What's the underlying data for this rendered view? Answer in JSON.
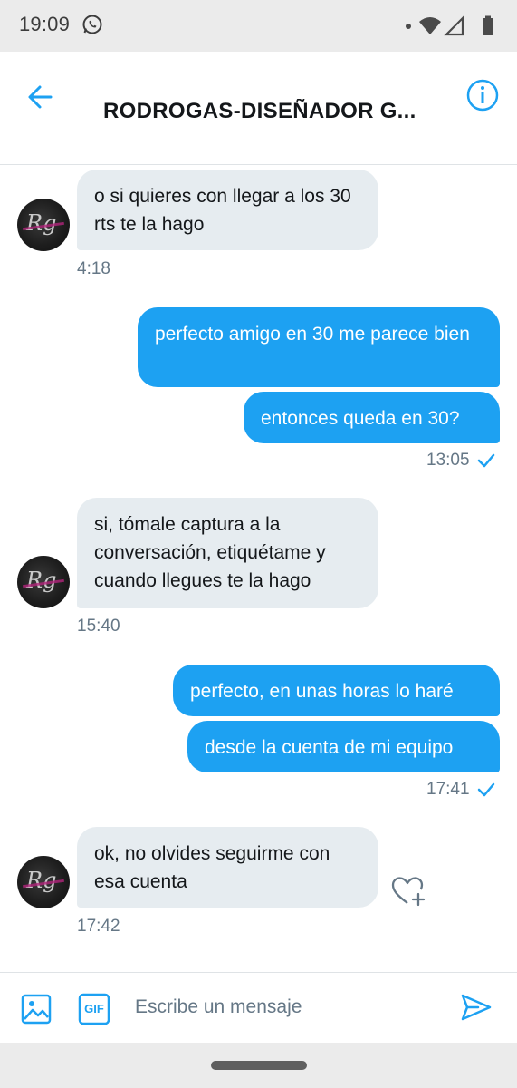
{
  "status_bar": {
    "time": "19:09",
    "battery": "79"
  },
  "header": {
    "title": "RODROGAS-DISEÑADOR G..."
  },
  "messages": [
    {
      "direction": "incoming",
      "text": "o si quieres con llegar a los 30 rts te la hago",
      "time": "4:18"
    },
    {
      "direction": "outgoing",
      "text": "perfecto amigo en 30 me parece bien"
    },
    {
      "direction": "outgoing",
      "text": "entonces queda en 30?",
      "time": "13:05"
    },
    {
      "direction": "incoming",
      "text": "si, tómale captura a la conversación, etiquétame y cuando llegues te la hago",
      "time": "15:40"
    },
    {
      "direction": "outgoing",
      "text": "perfecto, en unas horas lo haré"
    },
    {
      "direction": "outgoing",
      "text": "desde la cuenta de mi equipo",
      "time": "17:41"
    },
    {
      "direction": "incoming",
      "text": "ok, no olvides seguirme con esa cuenta",
      "time": "17:42"
    }
  ],
  "composer": {
    "placeholder": "Escribe un mensaje",
    "gif_label": "GIF"
  },
  "colors": {
    "accent": "#1da1f2",
    "incoming_bubble": "#e6ecf0",
    "meta_text": "#657786"
  }
}
